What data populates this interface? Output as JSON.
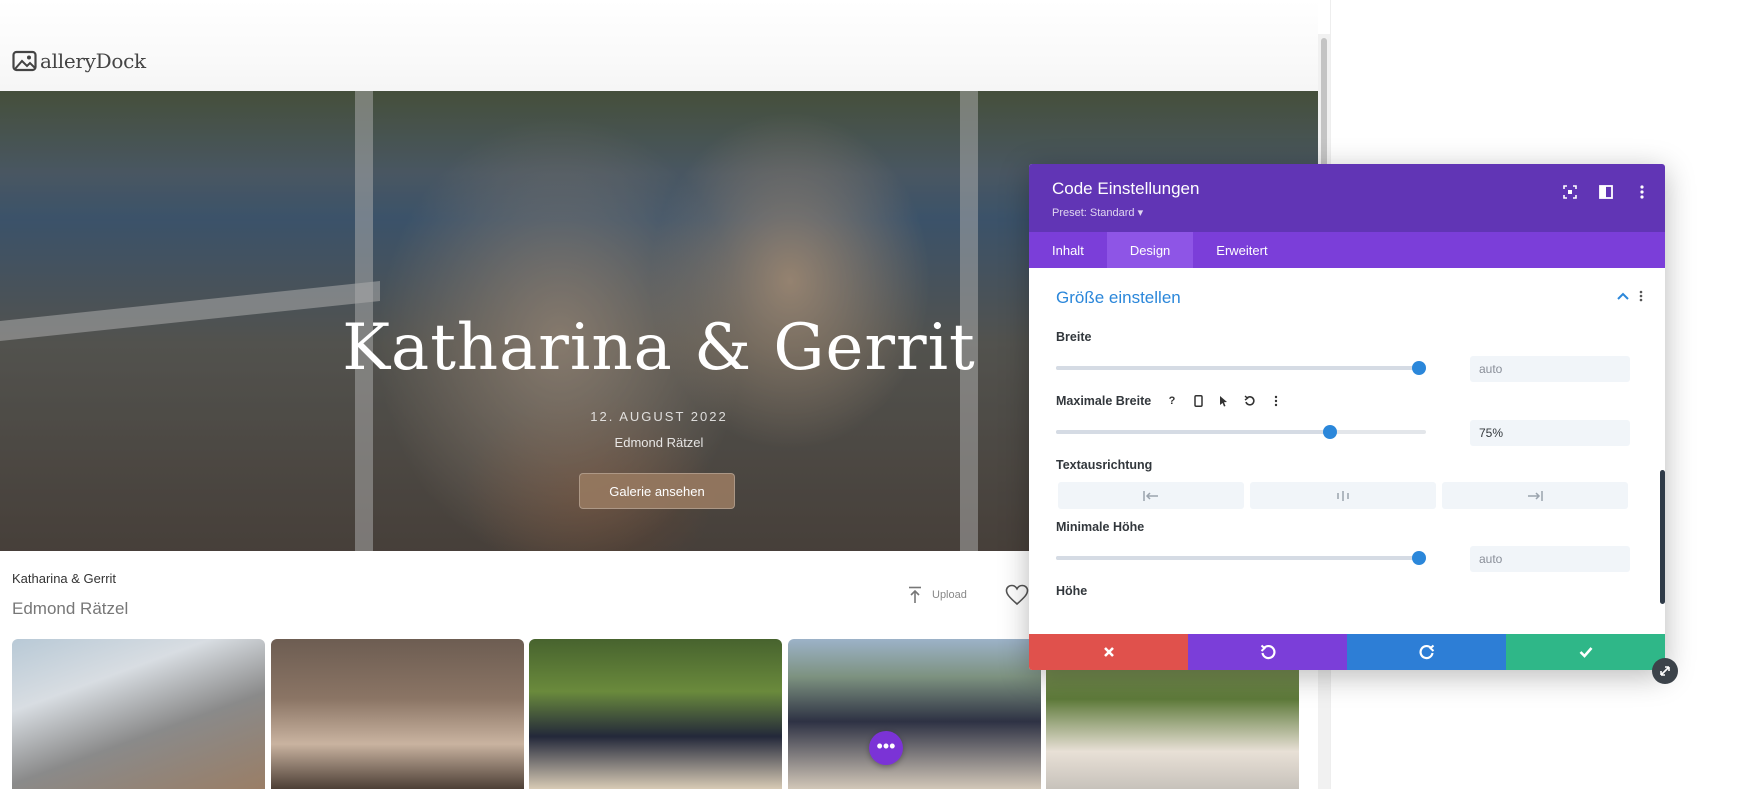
{
  "site": {
    "logo_text": "alleryDock",
    "hero": {
      "title": "Katharina & Gerrit",
      "date": "12. AUGUST 2022",
      "photographer": "Edmond Rätzel",
      "button_label": "Galerie ansehen"
    },
    "gallery": {
      "title": "Katharina & Gerrit",
      "subtitle": "Edmond Rätzel",
      "upload_label": "Upload"
    },
    "thumbnails": [
      "photo-1",
      "photo-2",
      "photo-3",
      "photo-4",
      "photo-5"
    ],
    "fab_label": "•••"
  },
  "panel": {
    "title": "Code Einstellungen",
    "preset": "Preset: Standard ▾",
    "tabs": [
      {
        "label": "Inhalt",
        "active": false
      },
      {
        "label": "Design",
        "active": true
      },
      {
        "label": "Erweitert",
        "active": false
      }
    ],
    "section_title": "Größe einstellen",
    "fields": {
      "width": {
        "label": "Breite",
        "value": "auto",
        "slider": 0.98
      },
      "max_width": {
        "label": "Maximale Breite",
        "value": "75%",
        "slider": 0.74
      },
      "text_align": {
        "label": "Textausrichtung"
      },
      "min_height": {
        "label": "Minimale Höhe",
        "value": "auto",
        "slider": 0.98
      },
      "height": {
        "label": "Höhe"
      }
    },
    "footer": {
      "cancel_icon": "close-icon",
      "undo_icon": "undo-icon",
      "redo_icon": "redo-icon",
      "save_icon": "check-icon"
    }
  },
  "colors": {
    "panel_header": "#6135b5",
    "panel_tabs": "#7b3ed9",
    "accent_blue": "#2b87da",
    "cancel_red": "#e0514c",
    "save_green": "#2fb788",
    "hero_button": "#96785f"
  }
}
